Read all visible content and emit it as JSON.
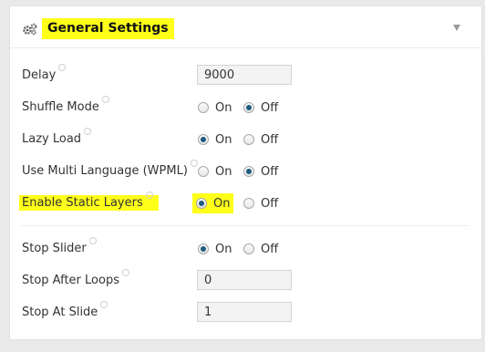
{
  "panel": {
    "title": "General Settings",
    "icon": "gears-icon",
    "collapse_icon": "triangle-down-icon"
  },
  "settings": [
    {
      "label": "Delay",
      "type": "text",
      "value": "9000"
    },
    {
      "label": "Shuffle Mode",
      "type": "radio",
      "on_label": "On",
      "off_label": "Off",
      "selected": "Off"
    },
    {
      "label": "Lazy Load",
      "type": "radio",
      "on_label": "On",
      "off_label": "Off",
      "selected": "On"
    },
    {
      "label": "Use Multi Language (WPML)",
      "type": "radio",
      "on_label": "On",
      "off_label": "Off",
      "selected": "Off"
    },
    {
      "label": "Enable Static Layers",
      "type": "radio",
      "on_label": "On",
      "off_label": "Off",
      "selected": "On"
    },
    {
      "label": "Stop Slider",
      "type": "radio",
      "on_label": "On",
      "off_label": "Off",
      "selected": "On"
    },
    {
      "label": "Stop After Loops",
      "type": "text",
      "value": "0"
    },
    {
      "label": "Stop At Slide",
      "type": "text",
      "value": "1"
    }
  ],
  "colors": {
    "highlight": "#ffff1a",
    "radio_selected": "#1e5a80",
    "background": "#e9e9e9"
  }
}
